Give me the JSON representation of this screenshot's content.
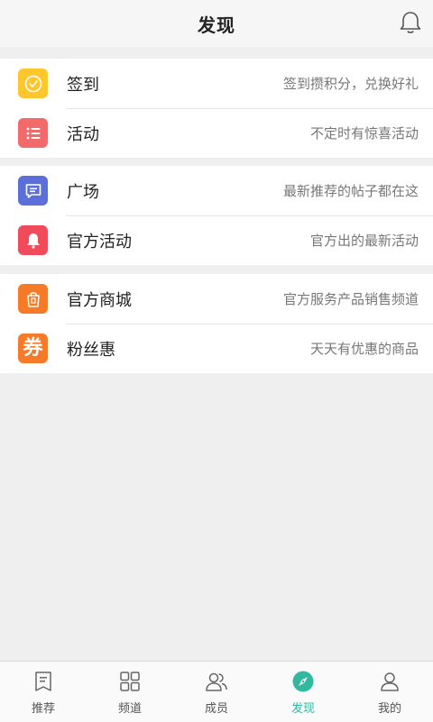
{
  "header": {
    "title": "发现"
  },
  "groups": [
    {
      "items": [
        {
          "label": "签到",
          "desc": "签到攒积分，兑换好礼",
          "icon": "check-circle-icon",
          "color": "#ffc72c"
        },
        {
          "label": "活动",
          "desc": "不定时有惊喜活动",
          "icon": "list-icon",
          "color": "#f26a6a"
        }
      ]
    },
    {
      "items": [
        {
          "label": "广场",
          "desc": "最新推荐的帖子都在这",
          "icon": "chat-icon",
          "color": "#5c6fd8"
        },
        {
          "label": "官方活动",
          "desc": "官方出的最新活动",
          "icon": "bell-icon",
          "color": "#f14a5a"
        }
      ]
    },
    {
      "items": [
        {
          "label": "官方商城",
          "desc": "官方服务产品销售频道",
          "icon": "shopping-bag-icon",
          "color": "#f77a28"
        },
        {
          "label": "粉丝惠",
          "desc": "天天有优惠的商品",
          "icon": "coupon-icon",
          "color": "#f77a28",
          "glyph": "券"
        }
      ]
    }
  ],
  "tabbar": {
    "tabs": [
      {
        "label": "推荐",
        "icon": "bookmark-icon"
      },
      {
        "label": "频道",
        "icon": "grid-icon"
      },
      {
        "label": "成员",
        "icon": "members-icon"
      },
      {
        "label": "发现",
        "icon": "compass-icon",
        "active": true
      },
      {
        "label": "我的",
        "icon": "user-icon"
      }
    ],
    "active_color": "#33b8a0"
  }
}
